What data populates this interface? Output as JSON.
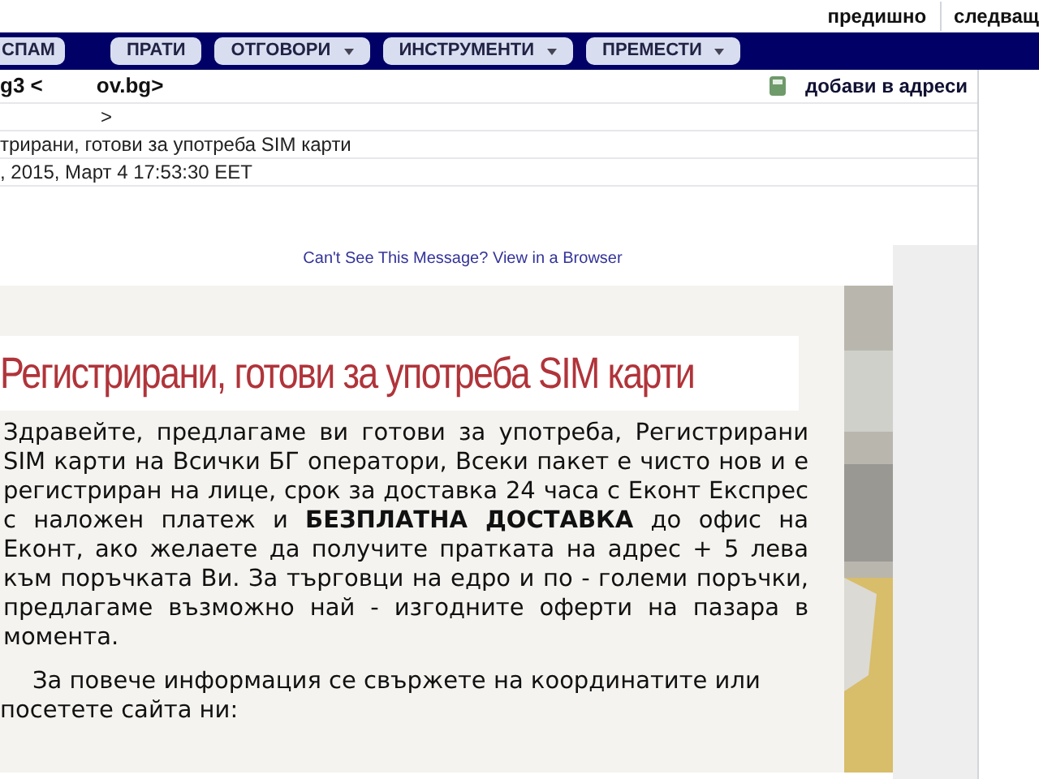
{
  "pager": {
    "previous": "предишно",
    "next": "следващ"
  },
  "toolbar": [
    {
      "label": "СПАМ",
      "dropdown": false
    },
    {
      "label": "ПРАТИ",
      "dropdown": false
    },
    {
      "label": "ОТГОВОРИ",
      "dropdown": true
    },
    {
      "label": "ИНСТРУМЕНТИ",
      "dropdown": true
    },
    {
      "label": "ПРЕМЕСТИ",
      "dropdown": true
    }
  ],
  "header": {
    "from_start": "g3 <",
    "from_end": "ov.bg>",
    "add_to_contacts": "добави в адреси",
    "to": ">",
    "subject": "трирани, готови за употреба SIM карти",
    "date": ", 2015, Март 4 17:53:30 EET"
  },
  "message": {
    "view_link": "Can't See This Message? View in a Browser",
    "title": "Регистрирани, готови за употреба SIM карти",
    "paragraphs": [
      "Здравейте, предлагаме ви готови за употреба, Регистрирани SIM карти на Всички БГ оператори, Всеки пакет е чисто нов и е регистриран на лице, срок за доставка 24 часа с Еконт Експрес с наложен платеж и **БЕЗПЛАТНА ДОСТАВКА** до офис на Еконт, ако желаете да получите пратката на адрес + 5 лева към поръчката Ви. За търговци на едро и по - големи поръчки, предлагаме възможно най - изгодните оферти на пазара в момента.",
      "За повече информация се свържете на координатите или посетете сайта ни:"
    ]
  }
}
